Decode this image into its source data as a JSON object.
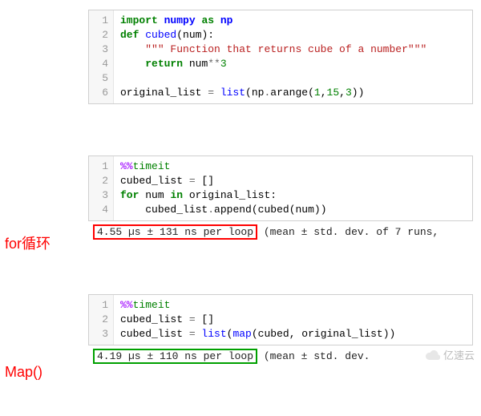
{
  "cell1": {
    "line_numbers": [
      "1",
      "2",
      "3",
      "4",
      "5",
      "6"
    ],
    "tokens": {
      "import": "import",
      "numpy": "numpy",
      "as": "as",
      "np": "np",
      "def": "def",
      "cubed": "cubed",
      "lpar": "(",
      "num_param": "num",
      "rpar": ")",
      "colon": ":",
      "docstring": "\"\"\" Function that returns cube of a number\"\"\"",
      "return": "return",
      "num_var": "num",
      "starstar": "**",
      "three": "3",
      "original_list": "original_list",
      "eq": " = ",
      "list": "list",
      "np2": "np",
      "dot": ".",
      "arange": "arange",
      "one": "1",
      "comma": ",",
      "fifteen": "15",
      "three2": "3"
    }
  },
  "label_for": "for循环",
  "cell2": {
    "line_numbers": [
      "1",
      "2",
      "3",
      "4"
    ],
    "tokens": {
      "timeit_pct": "%%",
      "timeit": "timeit",
      "cubed_list": "cubed_list",
      "eq": " = ",
      "lbracket": "[",
      "rbracket": "]",
      "for": "for",
      "num": "num",
      "in": "in",
      "original_list": "original_list",
      "colon": ":",
      "append": "append",
      "cubed": "cubed",
      "lpar": "(",
      "rpar": ")",
      "dot": "."
    },
    "output_highlight": "4.55 µs ± 131 ns per loop",
    "output_rest": " (mean ± std. dev. of 7 runs,"
  },
  "label_map": "Map()",
  "cell3": {
    "line_numbers": [
      "1",
      "2",
      "3"
    ],
    "tokens": {
      "timeit_pct": "%%",
      "timeit": "timeit",
      "cubed_list": "cubed_list",
      "eq": " = ",
      "lbracket": "[",
      "rbracket": "]",
      "list": "list",
      "map": "map",
      "cubed": "cubed",
      "comma": ", ",
      "original_list": "original_list",
      "lpar": "(",
      "rpar": ")"
    },
    "output_highlight": "4.19 µs ± 110 ns per loop",
    "output_rest": " (mean ± std. dev."
  },
  "watermark": "亿速云"
}
